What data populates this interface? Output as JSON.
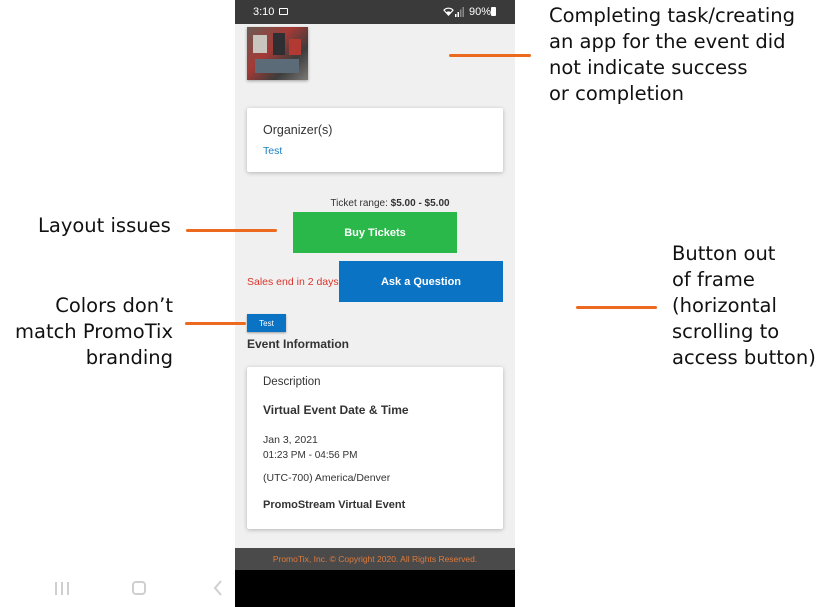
{
  "status_bar": {
    "time": "3:10",
    "battery": "90%"
  },
  "organizer_card": {
    "title": "Organizer(s)",
    "link": "Test"
  },
  "tickets": {
    "range_label": "Ticket range:",
    "range_value": "$5.00 - $5.00",
    "buy_label": "Buy Tickets",
    "sales_end": "Sales end in 2 days",
    "ask_label": "Ask a Question",
    "test_label": "Test"
  },
  "event_info": {
    "heading": "Event Information",
    "description_title": "Description",
    "virtual_title": "Virtual Event Date & Time",
    "date": "Jan 3, 2021",
    "time": "01:23 PM - 04:56 PM",
    "timezone": "(UTC-700) America/Denver",
    "event_name": "PromoStream Virtual Event"
  },
  "footer": {
    "copyright": "PromoTix, Inc. © Copyright 2020. All Rights Reserved."
  },
  "annotations": {
    "completion": [
      "Completing task/creating",
      "an app for the event did",
      "not indicate success",
      "or completion"
    ],
    "layout": "Layout issues",
    "colors": [
      "Colors don’t",
      "match PromoTix",
      "branding"
    ],
    "button": [
      "Button out",
      "of frame",
      "(horizontal",
      "scrolling to",
      "access button)"
    ]
  },
  "colors": {
    "annotation_line": "#ec6a1f",
    "buy_button": "#2bb84a",
    "ask_button": "#0a73c4",
    "sales_text": "#d9342b",
    "link": "#1a7fc4",
    "footer_text": "#e07a3a"
  },
  "icons": [
    "gallery-icon",
    "wifi-icon",
    "signal-icon",
    "battery-icon",
    "recent-apps-icon",
    "home-icon",
    "back-icon"
  ]
}
